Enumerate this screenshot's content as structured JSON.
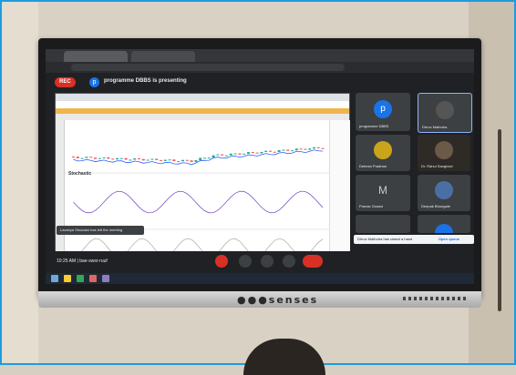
{
  "meet": {
    "rec_label": "REC",
    "presenter_initial": "p",
    "presenting_text": "programme DBBS is presenting",
    "meeting_time": "10:25 AM",
    "meeting_code": "bae-swsr-ruuf"
  },
  "presentation": {
    "indicator_name": "Stochastic",
    "toast_text": "Lavanya Shukalar has left the meeting"
  },
  "participants": [
    {
      "name": "programme DBBS",
      "initial": "p",
      "avatar_color": "#1a73e8"
    },
    {
      "name": "Dhruv Malhotra"
    },
    {
      "name": "Debesh Pradhan"
    },
    {
      "name": "Dr. Rahul Sanghavi"
    },
    {
      "name": "Pranav Gosavi",
      "initial": "M"
    },
    {
      "name": "Deepak Bhongale"
    }
  ],
  "hand_notice": {
    "text": "Dhruv Malhotra has raised a hand",
    "action": "Open queue"
  },
  "tv": {
    "brand": "senses"
  }
}
